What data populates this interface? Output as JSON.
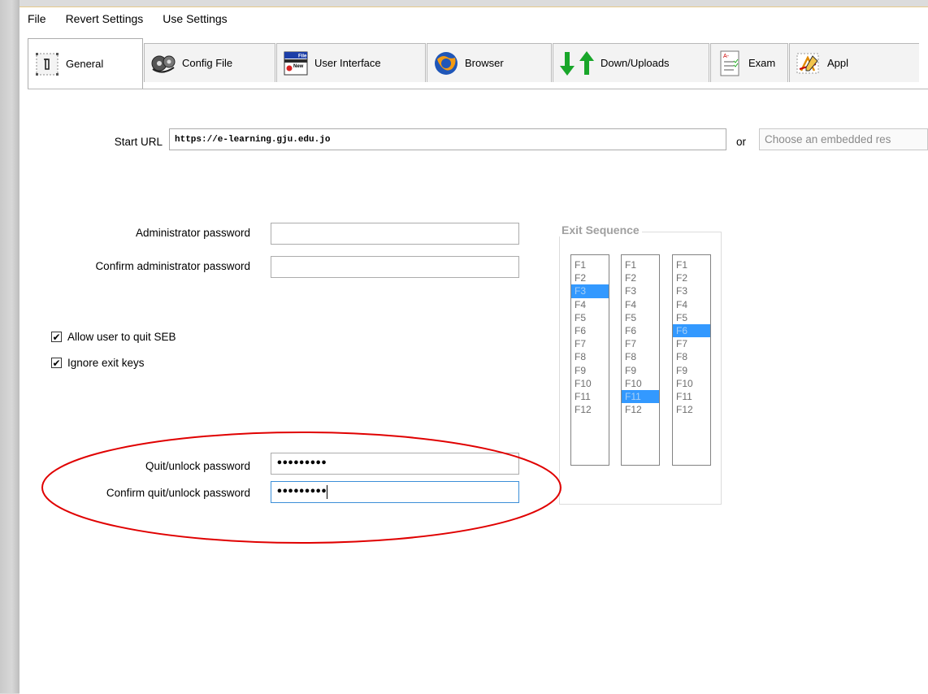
{
  "menu": [
    "File",
    "Revert Settings",
    "Use Settings"
  ],
  "tabs": [
    {
      "label": "General",
      "icon": "general-icon",
      "active": true
    },
    {
      "label": "Config File",
      "icon": "config-file-icon"
    },
    {
      "label": "User Interface",
      "icon": "user-interface-icon"
    },
    {
      "label": "Browser",
      "icon": "browser-icon"
    },
    {
      "label": "Down/Uploads",
      "icon": "down-uploads-icon"
    },
    {
      "label": "Exam",
      "icon": "exam-icon"
    },
    {
      "label": "Appl",
      "icon": "applications-icon"
    }
  ],
  "start_url": {
    "label": "Start URL",
    "value": "https://e-learning.gju.edu.jo",
    "or_label": "or",
    "embedded_placeholder": "Choose an embedded res"
  },
  "admin": {
    "password_label": "Administrator password",
    "password_value": "",
    "confirm_label": "Confirm administrator password",
    "confirm_value": ""
  },
  "options": {
    "allow_quit_label": "Allow user to quit SEB",
    "allow_quit_checked": true,
    "ignore_exit_label": "Ignore exit keys",
    "ignore_exit_checked": true
  },
  "quit": {
    "password_label": "Quit/unlock password",
    "password_value": "•••••••••",
    "confirm_label": "Confirm quit/unlock password",
    "confirm_value": "•••••••••"
  },
  "exit_sequence": {
    "title": "Exit Sequence",
    "keys": [
      "F1",
      "F2",
      "F3",
      "F4",
      "F5",
      "F6",
      "F7",
      "F8",
      "F9",
      "F10",
      "F11",
      "F12"
    ],
    "selected": [
      "F3",
      "F11",
      "F6"
    ]
  },
  "colors": {
    "selection": "#3399ff",
    "annotation_ellipse": "#e00000"
  }
}
